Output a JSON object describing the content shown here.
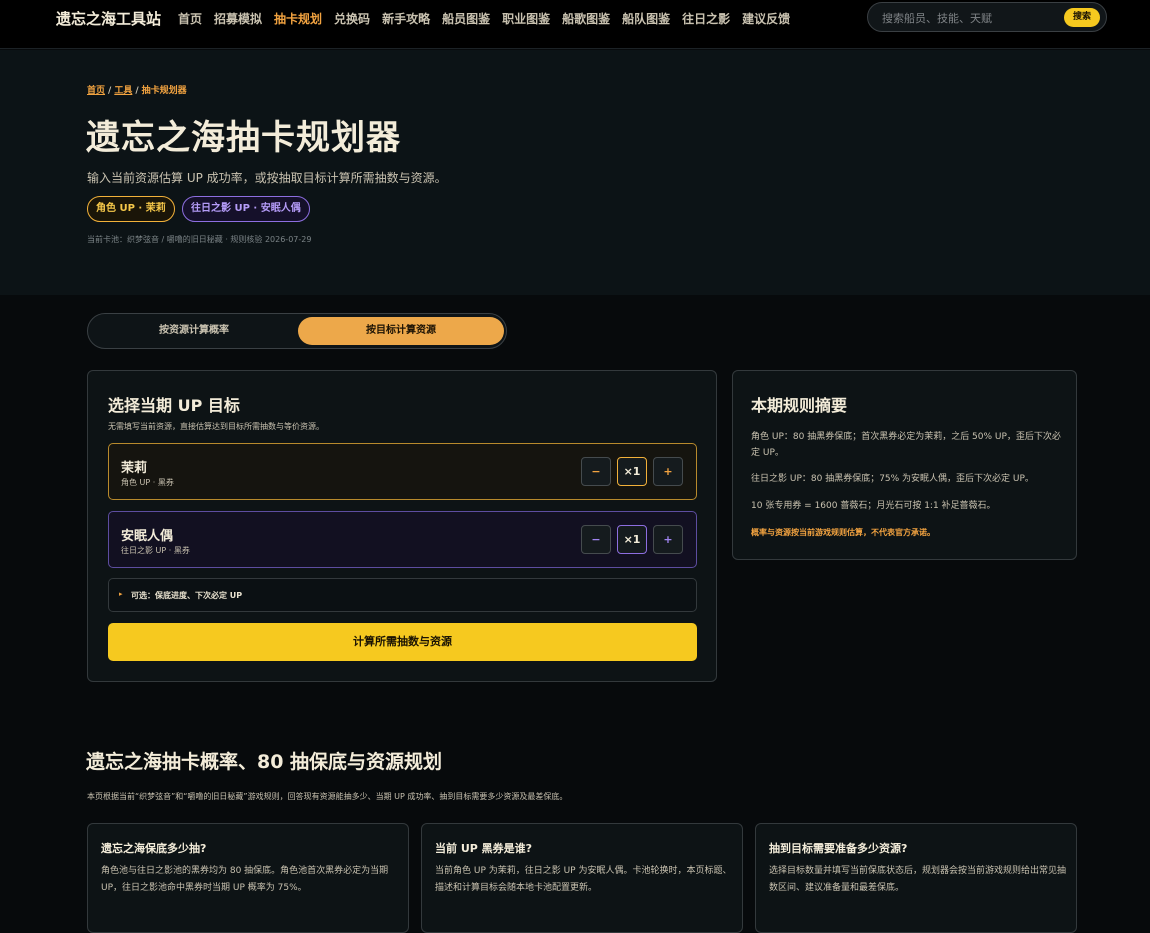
{
  "nav": {
    "brand": "遗忘之海工具站",
    "links": [
      "首页",
      "招募模拟",
      "抽卡规划",
      "兑换码",
      "新手攻略",
      "船员图鉴",
      "职业图鉴",
      "船歌图鉴",
      "船队图鉴",
      "往日之影",
      "建议反馈"
    ],
    "active_index": 2,
    "search_placeholder": "搜索船员、技能、天赋",
    "search_button": "搜索"
  },
  "hero": {
    "breadcrumb": [
      "首页",
      "工具",
      "抽卡规划器"
    ],
    "title": "遗忘之海抽卡规划器",
    "subtitle": "输入当前资源估算 UP 成功率，或按抽取目标计算所需抽数与资源。",
    "pills": [
      "角色 UP · 茉莉",
      "往日之影 UP · 安眠人偶"
    ],
    "meta": "当前卡池：织梦弦音 / 嚼噜的旧日秘藏 · 规则核验 2026-07-29"
  },
  "modes": {
    "by_resource": "按资源计算概率",
    "by_target": "按目标计算资源",
    "selected": "by_target"
  },
  "target_panel": {
    "title": "选择当期 UP 目标",
    "desc": "无需填写当前资源，直接估算达到目标所需抽数与等价资源。",
    "targets": [
      {
        "name": "茉莉",
        "tag": "角色 UP · 黑券",
        "minus": "−",
        "count": "×1",
        "plus": "+"
      },
      {
        "name": "安眠人偶",
        "tag": "往日之影 UP · 黑券",
        "minus": "−",
        "count": "×1",
        "plus": "+"
      }
    ],
    "optional_toggle": "▸",
    "optional_label": "可选：保底进度、下次必定 UP",
    "calculate": "计算所需抽数与资源"
  },
  "rules": {
    "title": "本期规则摘要",
    "items": [
      "角色 UP：80 抽黑券保底；首次黑券必定为茉莉，之后 50% UP，歪后下次必定 UP。",
      "往日之影 UP：80 抽黑券保底；75% 为安眠人偶，歪后下次必定 UP。",
      "10 张专用券 = 1600 蔷薇石；月光石可按 1:1 补足蔷薇石。"
    ],
    "note": "概率与资源按当前游戏规则估算，不代表官方承诺。"
  },
  "faq_section": {
    "title": "遗忘之海抽卡概率、80 抽保底与资源规划",
    "subtitle": "本页根据当前“织梦弦音”和“嚼噜的旧日秘藏”游戏规则，回答现有资源能抽多少、当期 UP 成功率、抽到目标需要多少资源及最差保底。",
    "cards": [
      {
        "q": "遗忘之海保底多少抽?",
        "a": "角色池与往日之影池的黑券均为 80 抽保底。角色池首次黑券必定为当期 UP，往日之影池命中黑券时当期 UP 概率为 75%。"
      },
      {
        "q": "当前 UP 黑券是谁?",
        "a": "当前角色 UP 为茉莉，往日之影 UP 为安眠人偶。卡池轮换时，本页标题、描述和计算目标会随本地卡池配置更新。"
      },
      {
        "q": "抽到目标需要准备多少资源?",
        "a": "选择目标数量并填写当前保底状态后，规划器会按当前游戏规则给出常见抽数区间、建议准备量和最差保底。"
      }
    ]
  },
  "colors": {
    "accent_orange": "#f2a340",
    "accent_yellow": "#f6c91f",
    "accent_violet": "#8d6ee0",
    "background": "#070a0c"
  }
}
